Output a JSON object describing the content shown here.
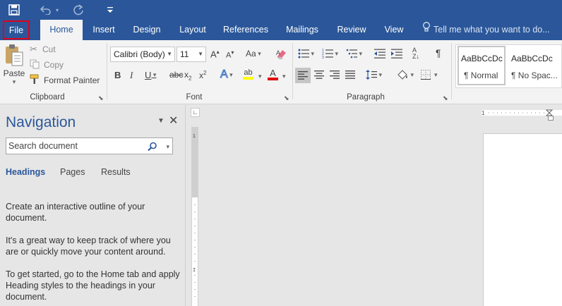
{
  "quick_access": {
    "save_icon": "save-icon",
    "undo_icon": "undo-icon",
    "redo_icon": "redo-icon",
    "customize_icon": "customize-qat-icon"
  },
  "tabs": [
    {
      "label": "File"
    },
    {
      "label": "Home"
    },
    {
      "label": "Insert"
    },
    {
      "label": "Design"
    },
    {
      "label": "Layout"
    },
    {
      "label": "References"
    },
    {
      "label": "Mailings"
    },
    {
      "label": "Review"
    },
    {
      "label": "View"
    }
  ],
  "tell_me": "Tell me what you want to do...",
  "ribbon": {
    "clipboard": {
      "group": "Clipboard",
      "paste": "Paste",
      "cut": "Cut",
      "copy": "Copy",
      "format_painter": "Format Painter"
    },
    "font": {
      "group": "Font",
      "font_name": "Calibri (Body)",
      "font_size": "11",
      "change_case": "Aa"
    },
    "paragraph": {
      "group": "Paragraph"
    },
    "styles": [
      {
        "preview": "AaBbCcDc",
        "name": "¶ Normal"
      },
      {
        "preview": "AaBbCcDc",
        "name": "¶ No Spac..."
      }
    ]
  },
  "navigation": {
    "title": "Navigation",
    "search_placeholder": "Search document",
    "tabs": [
      "Headings",
      "Pages",
      "Results"
    ],
    "paragraphs": [
      "Create an interactive outline of your document.",
      "It's a great way to keep track of where you are or quickly move your content around.",
      "To get started, go to the Home tab and apply Heading styles to the headings in your document."
    ]
  },
  "colors": {
    "accent": "#2b579a",
    "highlight": "#ffff00",
    "font_color": "#e00000",
    "file_outline": "#e0001b"
  }
}
